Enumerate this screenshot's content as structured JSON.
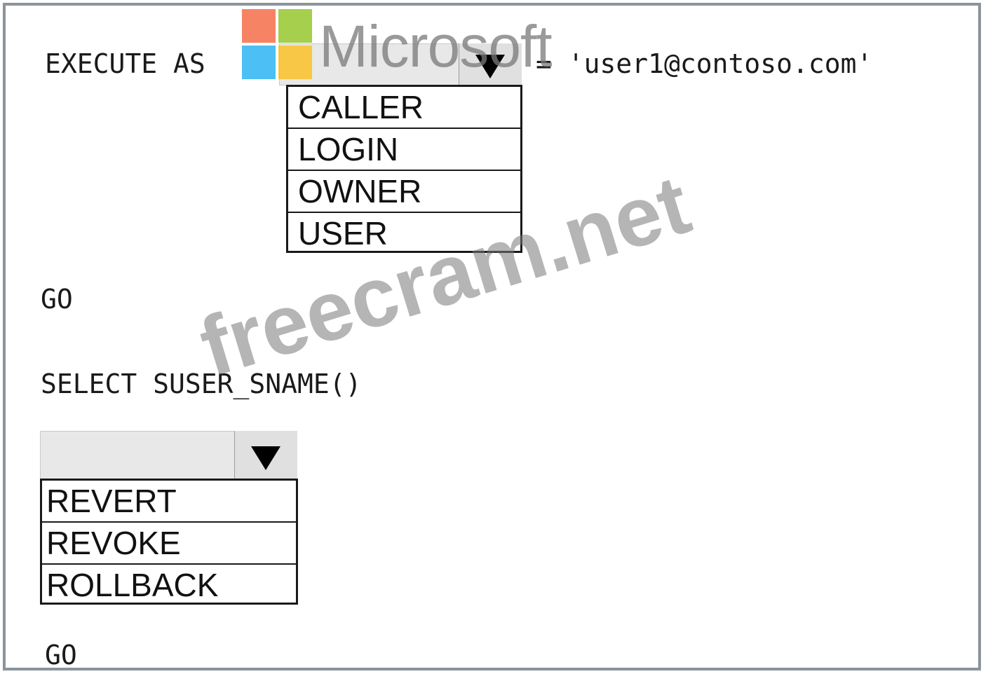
{
  "line1": {
    "prefix": "EXECUTE AS",
    "suffix": "= 'user1@contoso.com'"
  },
  "dropdown1": {
    "selected": "",
    "options": [
      "CALLER",
      "LOGIN",
      "OWNER",
      "USER"
    ]
  },
  "go1": "GO",
  "select_line": "SELECT SUSER_SNAME()",
  "dropdown2": {
    "selected": "",
    "options": [
      "REVERT",
      "REVOKE",
      "ROLLBACK"
    ]
  },
  "go2": "GO",
  "watermarks": {
    "brand": "Microsoft",
    "site": "freecram.net"
  },
  "colors": {
    "logo_red": "#f25022",
    "logo_green": "#7fba00",
    "logo_blue": "#00a4ef",
    "logo_yellow": "#ffb900",
    "border": "#8a949c"
  },
  "icons": {
    "dropdown_arrow": "caret-down-icon",
    "logo": "microsoft-logo"
  }
}
